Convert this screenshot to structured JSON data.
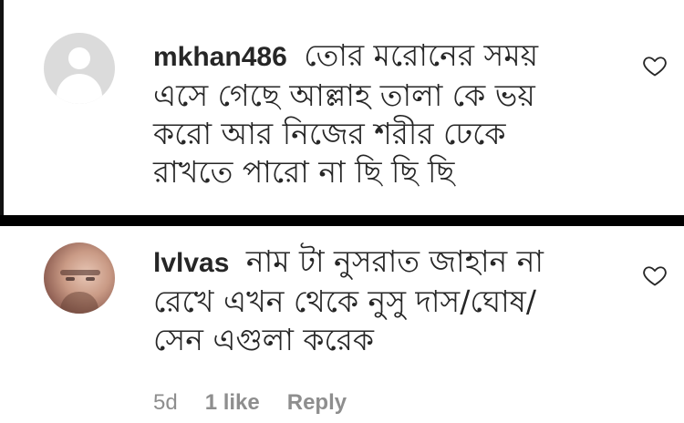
{
  "comments": [
    {
      "username": "mkhan486",
      "text": "তোর মরোনের সময় এসে গেছে আল্লাহ তালা কে ভয় করো আর নিজের শরীর ঢেকে রাখতে পারো না ছি ছি ছি",
      "avatar": "default-avatar-icon",
      "like_icon": "heart-outline-icon"
    },
    {
      "username": "lvlvas",
      "text": "নাম টা নুসরাত জাহান না রেখে এখন থেকে নুসু দাস/ঘোষ/সেন এগুলা করেক",
      "avatar": "profile-photo",
      "like_icon": "heart-outline-icon",
      "time": "5d",
      "likes": "1 like",
      "reply_label": "Reply"
    }
  ],
  "colors": {
    "text": "#262626",
    "meta": "#8e8e8e",
    "divider": "#000000",
    "avatar_bg": "#dbdbdb"
  }
}
